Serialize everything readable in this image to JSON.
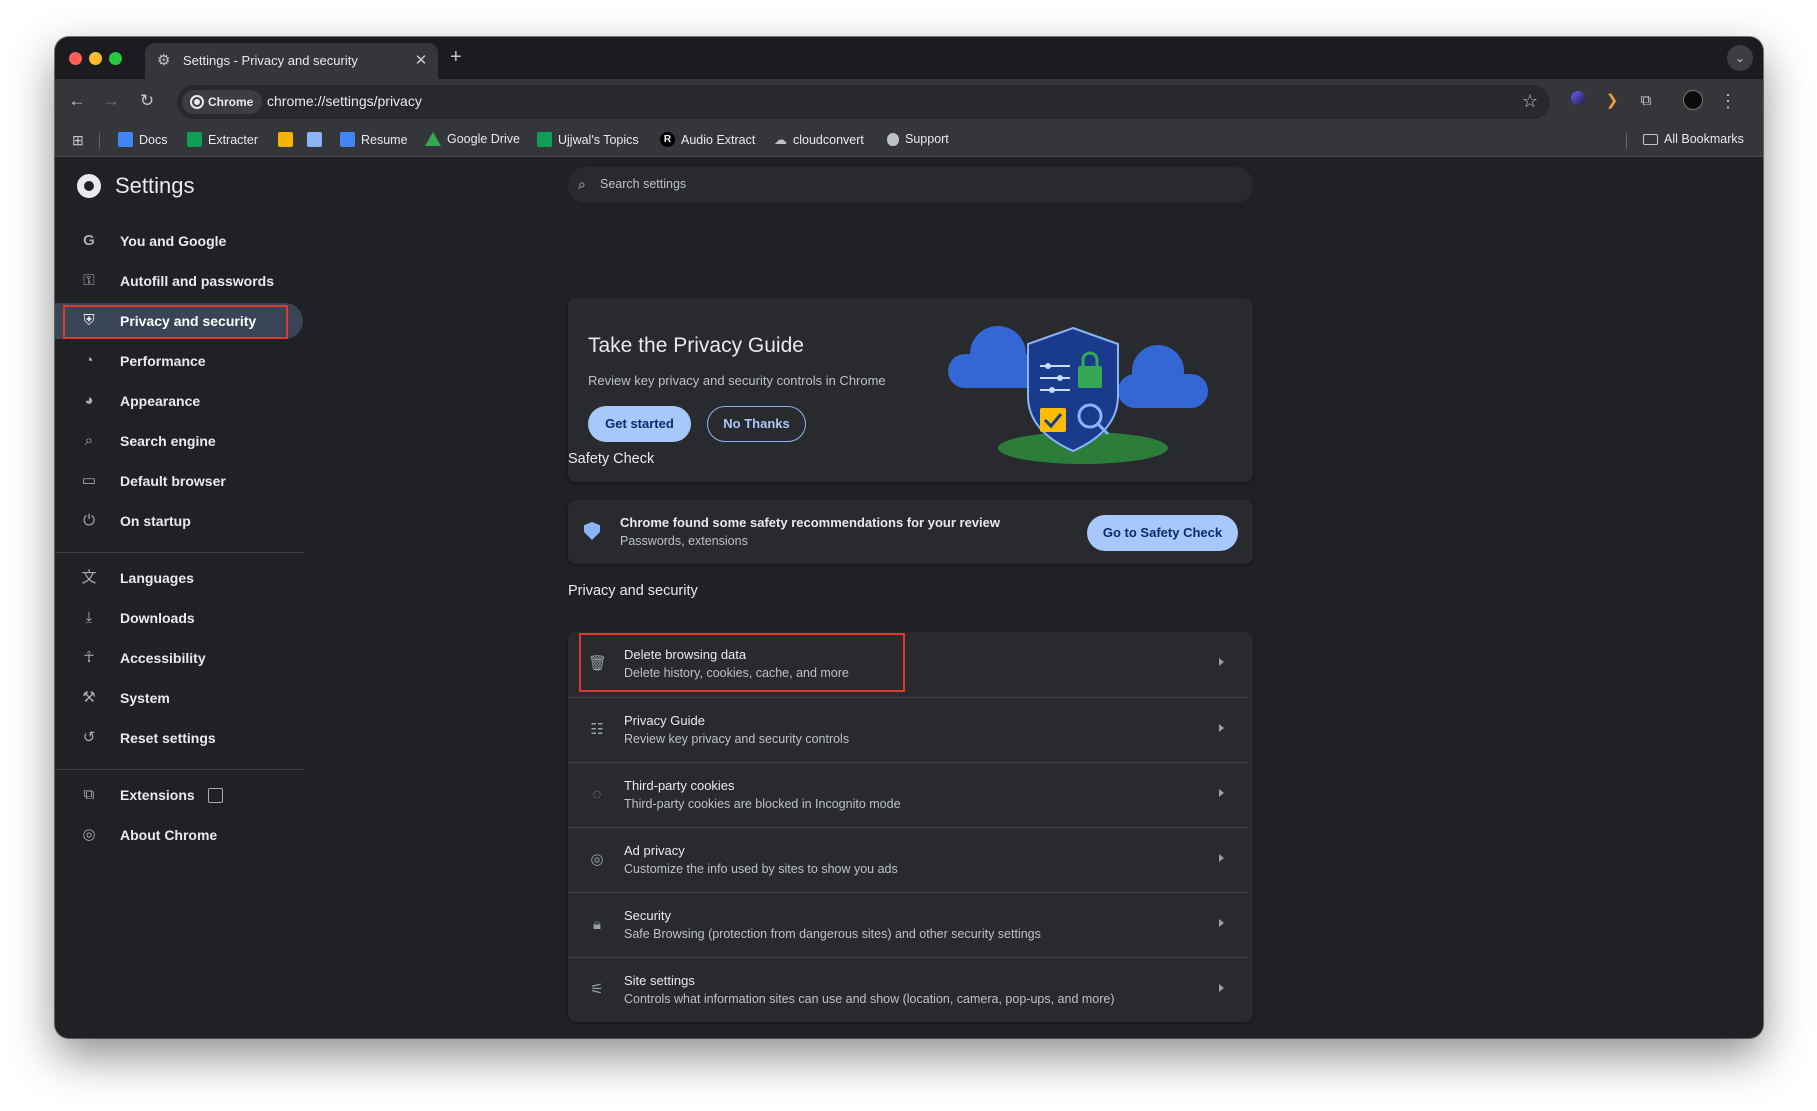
{
  "tab": {
    "title": "Settings - Privacy and security",
    "favicon": "gear-icon",
    "close": "✕"
  },
  "toolbar": {
    "chip_label": "Chrome",
    "url": "chrome://settings/privacy"
  },
  "bookmarks": {
    "items": [
      {
        "label": "Docs",
        "icon": "docs-icon",
        "color": "#4285f4"
      },
      {
        "label": "Extracter",
        "icon": "sheets-icon",
        "color": "#0f9d58"
      },
      {
        "label": "",
        "icon": "keep-icon",
        "color": "#f4b400"
      },
      {
        "label": "",
        "icon": "translate-icon",
        "color": "#8ab4f8"
      },
      {
        "label": "Resume",
        "icon": "docs-icon",
        "color": "#4285f4"
      },
      {
        "label": "Google Drive",
        "icon": "drive-icon",
        "color": "#34a853"
      },
      {
        "label": "Ujjwal's Topics",
        "icon": "sheets-icon",
        "color": "#0f9d58"
      },
      {
        "label": "Audio Extract",
        "icon": "r-logo-icon",
        "color": "#000000"
      },
      {
        "label": "cloudconvert",
        "icon": "cloud-icon",
        "color": "#bdc1c6"
      },
      {
        "label": "Support",
        "icon": "apple-icon",
        "color": "#bdc1c6"
      }
    ],
    "all_label": "All Bookmarks"
  },
  "sidebar": {
    "title": "Settings",
    "items": [
      {
        "label": "You and Google",
        "icon": "google-g-icon"
      },
      {
        "label": "Autofill and passwords",
        "icon": "key-icon"
      },
      {
        "label": "Privacy and security",
        "icon": "shield-icon"
      },
      {
        "label": "Performance",
        "icon": "speedometer-icon"
      },
      {
        "label": "Appearance",
        "icon": "palette-icon"
      },
      {
        "label": "Search engine",
        "icon": "search-icon"
      },
      {
        "label": "Default browser",
        "icon": "browser-window-icon"
      },
      {
        "label": "On startup",
        "icon": "power-icon"
      },
      {
        "label": "Languages",
        "icon": "translate-icon"
      },
      {
        "label": "Downloads",
        "icon": "download-icon"
      },
      {
        "label": "Accessibility",
        "icon": "accessibility-icon"
      },
      {
        "label": "System",
        "icon": "wrench-icon"
      },
      {
        "label": "Reset settings",
        "icon": "reset-icon"
      },
      {
        "label": "Extensions",
        "icon": "puzzle-icon"
      },
      {
        "label": "About Chrome",
        "icon": "chrome-icon"
      }
    ]
  },
  "search": {
    "placeholder": "Search settings"
  },
  "privacy_guide": {
    "title": "Take the Privacy Guide",
    "description": "Review key privacy and security controls in Chrome",
    "primary": "Get started",
    "secondary": "No Thanks"
  },
  "safety_check": {
    "heading": "Safety Check",
    "title": "Chrome found some safety recommendations for your review",
    "subtitle": "Passwords, extensions",
    "button": "Go to Safety Check"
  },
  "privacy_section": {
    "heading": "Privacy and security",
    "rows": [
      {
        "title": "Delete browsing data",
        "subtitle": "Delete history, cookies, cache, and more",
        "icon": "trash-icon"
      },
      {
        "title": "Privacy Guide",
        "subtitle": "Review key privacy and security controls",
        "icon": "privacy-guide-icon"
      },
      {
        "title": "Third-party cookies",
        "subtitle": "Third-party cookies are blocked in Incognito mode",
        "icon": "cookie-icon"
      },
      {
        "title": "Ad privacy",
        "subtitle": "Customize the info used by sites to show you ads",
        "icon": "ad-privacy-icon"
      },
      {
        "title": "Security",
        "subtitle": "Safe Browsing (protection from dangerous sites) and other security settings",
        "icon": "lock-icon"
      },
      {
        "title": "Site settings",
        "subtitle": "Controls what information sites can use and show (location, camera, pop-ups, and more)",
        "icon": "sliders-icon"
      }
    ]
  },
  "colors": {
    "accent": "#a8c7fa",
    "highlight": "#e0382e",
    "active_nav": "#394457"
  }
}
